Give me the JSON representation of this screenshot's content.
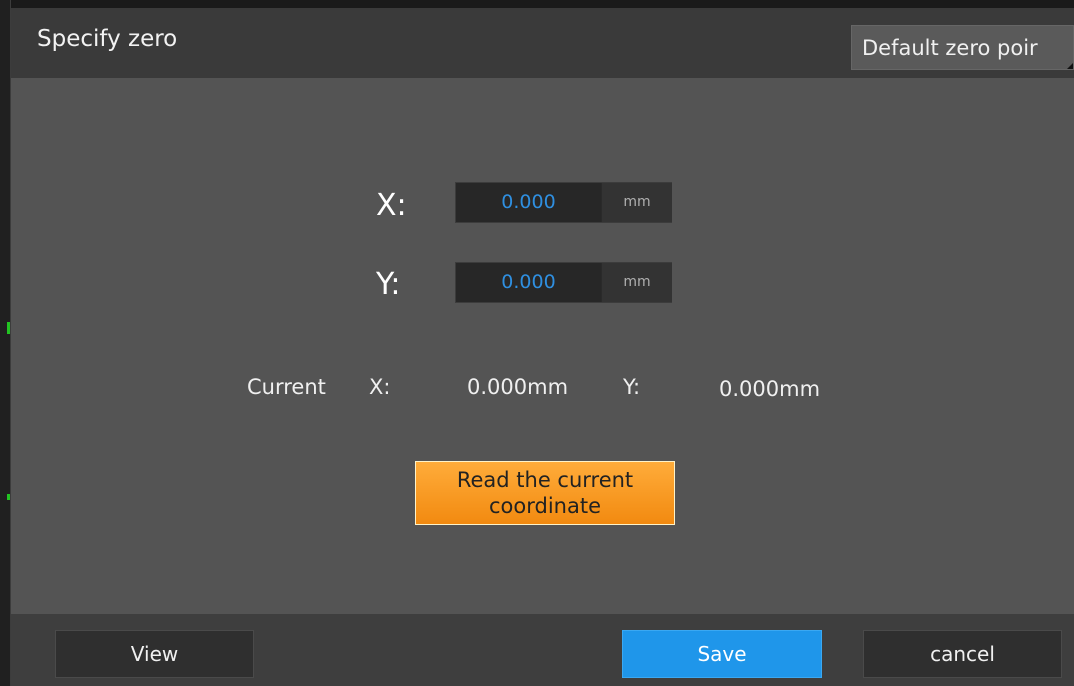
{
  "dialog": {
    "title": "Specify zero",
    "default_zero_button": "Default zero poir"
  },
  "inputs": {
    "x": {
      "label": "X:",
      "value": "0.000",
      "unit": "mm"
    },
    "y": {
      "label": "Y:",
      "value": "0.000",
      "unit": "mm"
    }
  },
  "current": {
    "label": "Current",
    "x_label": "X:",
    "x_value": "0.000mm",
    "y_label": "Y:",
    "y_value": "0.000mm"
  },
  "read_button": {
    "line1": "Read the current",
    "line2": "coordinate"
  },
  "footer": {
    "view_label": "View",
    "save_label": "Save",
    "cancel_label": "cancel"
  },
  "colors": {
    "accent_orange": "#f28a10",
    "accent_blue": "#1f96ea",
    "value_blue": "#2f8fe0"
  }
}
